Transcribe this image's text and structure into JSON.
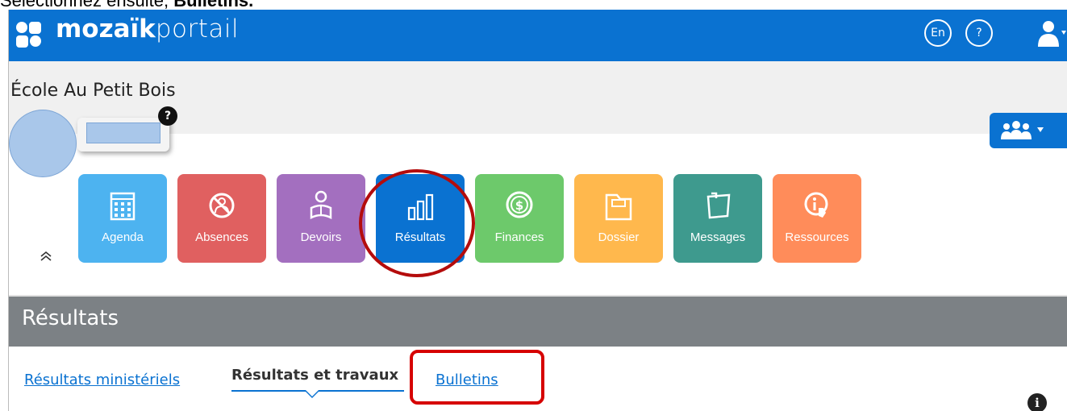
{
  "caption": {
    "prefix": "Sélectionnez ensuite, ",
    "bold": "Bulletins."
  },
  "header": {
    "brand_bold": "mozaïk",
    "brand_light": "portail",
    "lang_button": "En",
    "help_button": "?",
    "color": "#0a72d1"
  },
  "school": {
    "name": "École Au Petit Bois"
  },
  "profile": {
    "help_badge": "?"
  },
  "tiles": [
    {
      "label": "Agenda",
      "icon": "calendar-icon",
      "color": "#4db3f0"
    },
    {
      "label": "Absences",
      "icon": "no-person-icon",
      "color": "#e06060"
    },
    {
      "label": "Devoirs",
      "icon": "student-reading-icon",
      "color": "#a36fbf"
    },
    {
      "label": "Résultats",
      "icon": "bar-chart-icon",
      "color": "#0a72d1"
    },
    {
      "label": "Finances",
      "icon": "dollar-coin-icon",
      "color": "#6dc96b"
    },
    {
      "label": "Dossier",
      "icon": "folder-icon",
      "color": "#ffb84d"
    },
    {
      "label": "Messages",
      "icon": "message-note-icon",
      "color": "#3e9a8e"
    },
    {
      "label": "Ressources",
      "icon": "info-hand-icon",
      "color": "#ff8c5a"
    }
  ],
  "section": {
    "title": "Résultats"
  },
  "tabs": {
    "ministeriels": "Résultats ministériels",
    "travaux": "Résultats et travaux",
    "bulletins": "Bulletins"
  }
}
